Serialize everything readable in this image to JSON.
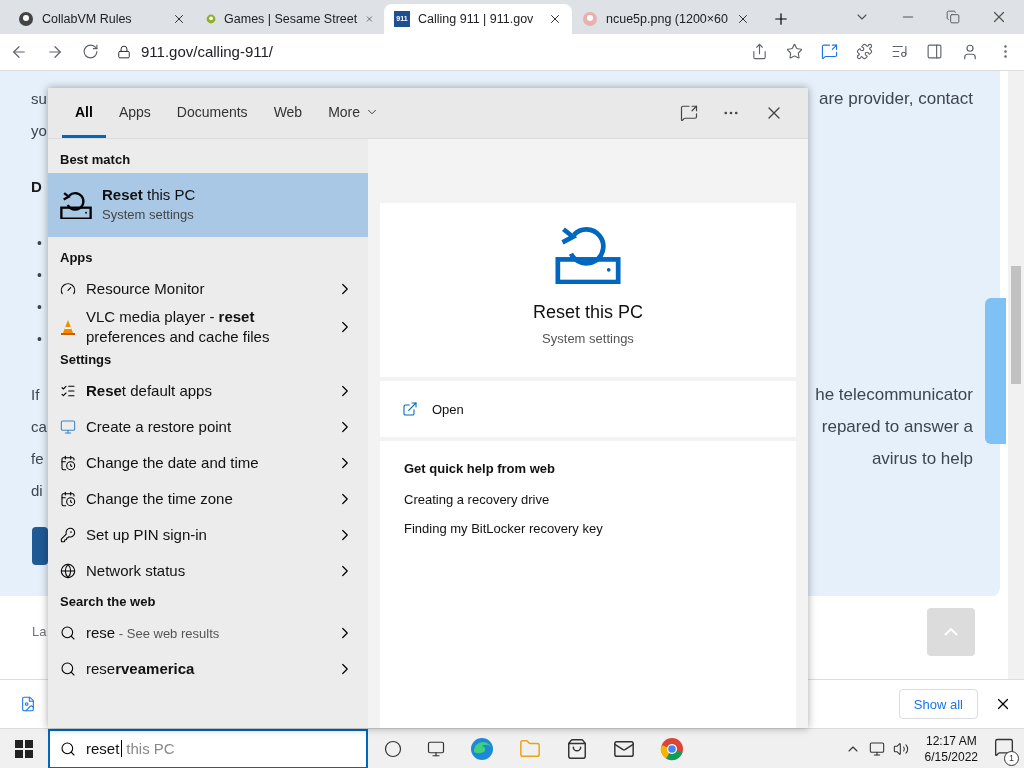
{
  "browser": {
    "tabs": [
      {
        "title": "CollabVM Rules",
        "selected": false
      },
      {
        "title": "Games | Sesame Street",
        "selected": false
      },
      {
        "title": "Calling 911 | 911.gov",
        "selected": true,
        "favicon_text": "911"
      },
      {
        "title": "ncue5p.png (1200×60",
        "selected": false
      }
    ],
    "address": "911.gov/calling-911/"
  },
  "page": {
    "lines": [
      {
        "kind": "text",
        "left": "su",
        "right": "are provider, contact"
      },
      {
        "kind": "text",
        "left": "yo"
      },
      {
        "kind": "heading",
        "left": "D"
      },
      {
        "kind": "bullet",
        "left": "•"
      },
      {
        "kind": "bullet",
        "left": "•"
      },
      {
        "kind": "bullet",
        "left": "•"
      },
      {
        "kind": "bullet",
        "left": "•"
      },
      {
        "kind": "text",
        "left": "If",
        "right": "he telecommunicator"
      },
      {
        "kind": "text",
        "left": "ca",
        "right": "repared to answer a"
      },
      {
        "kind": "text",
        "left": "fe",
        "right": "avirus to help"
      },
      {
        "kind": "text",
        "left": "di"
      },
      {
        "kind": "button"
      }
    ],
    "footer": "La"
  },
  "downloads": {
    "show_all": "Show all"
  },
  "search": {
    "filters": [
      {
        "label": "All",
        "selected": true,
        "kind": "tab"
      },
      {
        "label": "Apps",
        "selected": false,
        "kind": "tab"
      },
      {
        "label": "Documents",
        "selected": false,
        "kind": "tab"
      },
      {
        "label": "Web",
        "selected": false,
        "kind": "tab"
      },
      {
        "label": "More",
        "selected": false,
        "kind": "menu"
      }
    ],
    "sections": [
      {
        "heading": "Best match",
        "items": [
          {
            "kind": "best",
            "title": "**Reset** this PC",
            "subtitle": "System settings",
            "selected": true
          }
        ]
      },
      {
        "heading": "Apps",
        "items": [
          {
            "kind": "result",
            "title": "Resource Monitor",
            "selected": false
          },
          {
            "kind": "result",
            "title": "VLC media player - **reset** preferences and cache files",
            "selected": false
          }
        ]
      },
      {
        "heading": "Settings",
        "items": [
          {
            "kind": "result",
            "title": "**Rese**t default apps",
            "selected": false
          },
          {
            "kind": "result",
            "title": "Create a restore point",
            "selected": false
          },
          {
            "kind": "result",
            "title": "Change the date and time",
            "selected": false
          },
          {
            "kind": "result",
            "title": "Change the time zone",
            "selected": false
          },
          {
            "kind": "result",
            "title": "Set up PIN sign-in",
            "selected": false
          },
          {
            "kind": "result",
            "title": "Network status",
            "selected": false
          }
        ]
      },
      {
        "heading": "Search the web",
        "items": [
          {
            "kind": "result",
            "title": "rese",
            "hint": "- See web results",
            "selected": false
          },
          {
            "kind": "result",
            "title": "rese**rveamerica**",
            "selected": false
          }
        ]
      }
    ],
    "preview": {
      "title": "Reset this PC",
      "subtitle": "System settings",
      "action": "Open",
      "help_heading": "Get quick help from web",
      "links": [
        "Creating a recovery drive",
        "Finding my BitLocker recovery key"
      ]
    },
    "query": {
      "value": "reset",
      "suggestion": "this PC"
    }
  },
  "taskbar": {
    "time": "12:17 AM",
    "date": "6/15/2022",
    "notifications": "1"
  }
}
